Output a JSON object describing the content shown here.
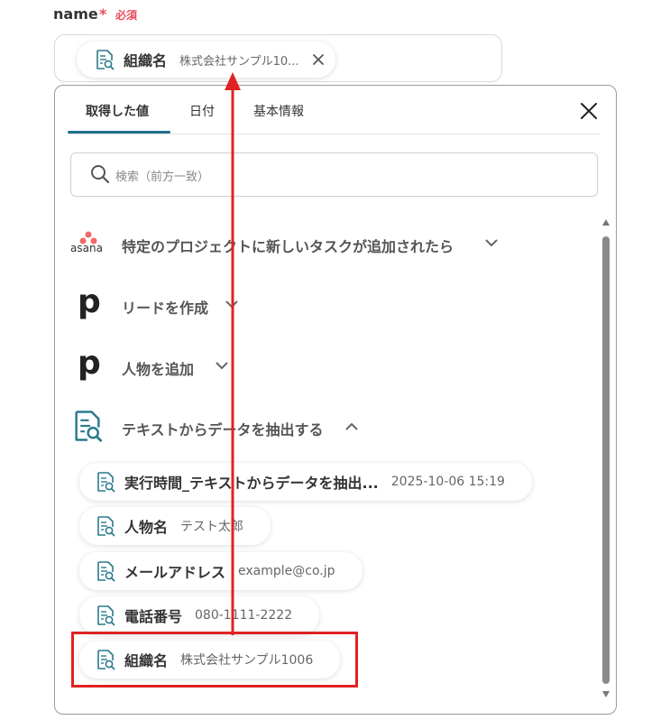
{
  "field": {
    "label": "name",
    "required_star": "*",
    "required_text": "必須"
  },
  "selected_chip": {
    "name": "組織名",
    "value": "株式会社サンプル10..."
  },
  "tabs": [
    {
      "label": "取得した値",
      "active": true
    },
    {
      "label": "日付",
      "active": false
    },
    {
      "label": "基本情報",
      "active": false
    }
  ],
  "search": {
    "placeholder": "検索（前方一致）"
  },
  "sections": [
    {
      "logo": "asana",
      "logo_text": "asana",
      "title": "特定のプロジェクトに新しいタスクが追加されたら",
      "expanded": false
    },
    {
      "logo": "p",
      "logo_text": "p",
      "title": "リードを作成",
      "expanded": false
    },
    {
      "logo": "p",
      "logo_text": "p",
      "title": "人物を追加",
      "expanded": false
    },
    {
      "logo": "doc-icon",
      "title": "テキストからデータを抽出する",
      "expanded": true
    }
  ],
  "items": [
    {
      "name": "実行時間_テキストからデータを抽出...",
      "value": "2025-10-06 15:19"
    },
    {
      "name": "人物名",
      "value": "テスト太郎"
    },
    {
      "name": "メールアドレス",
      "value": "example@co.jp"
    },
    {
      "name": "電話番号",
      "value": "080-1111-2222"
    },
    {
      "name": "組織名",
      "value": "株式会社サンプル1006"
    }
  ],
  "colors": {
    "accent": "#1f6f8b",
    "required": "#e84c5a",
    "annotation_red": "#e02222",
    "icon_teal": "#2b7a8c"
  }
}
